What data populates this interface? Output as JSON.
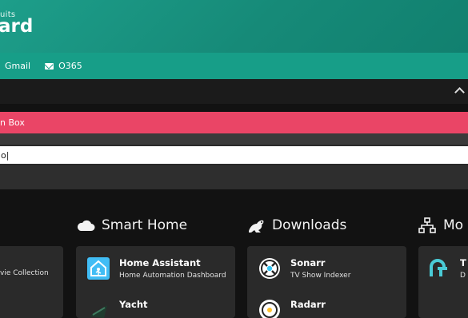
{
  "header": {
    "subtitle": "uits",
    "title": "ard"
  },
  "links": [
    {
      "label": "Gmail"
    },
    {
      "label": "O365"
    }
  ],
  "alert": {
    "text": "n Box"
  },
  "search": {
    "value": "o|"
  },
  "sections": [
    {
      "title": "Smart Home",
      "icon": "cloud-icon"
    },
    {
      "title": "Downloads",
      "icon": "frog-icon"
    },
    {
      "title": "Mo",
      "icon": "network-icon"
    }
  ],
  "movies_tile": {
    "desc": "vie Collection"
  },
  "smart_home_tiles": [
    {
      "title": "Home Assistant",
      "desc": "Home Automation Dashboard",
      "icon": "home-assistant-icon"
    },
    {
      "title": "Yacht",
      "desc": "",
      "icon": "yacht-icon"
    }
  ],
  "download_tiles": [
    {
      "title": "Sonarr",
      "desc": "TV Show Indexer",
      "icon": "sonarr-icon"
    },
    {
      "title": "Radarr",
      "desc": "",
      "icon": "radarr-icon"
    }
  ],
  "network_tiles": [
    {
      "title": "T",
      "desc": "D",
      "icon": "tp-link-icon"
    }
  ],
  "colors": {
    "header": "#1d9e8a",
    "linkbar": "#179e88",
    "alert": "#ea4566",
    "card": "#2a2a2a"
  }
}
